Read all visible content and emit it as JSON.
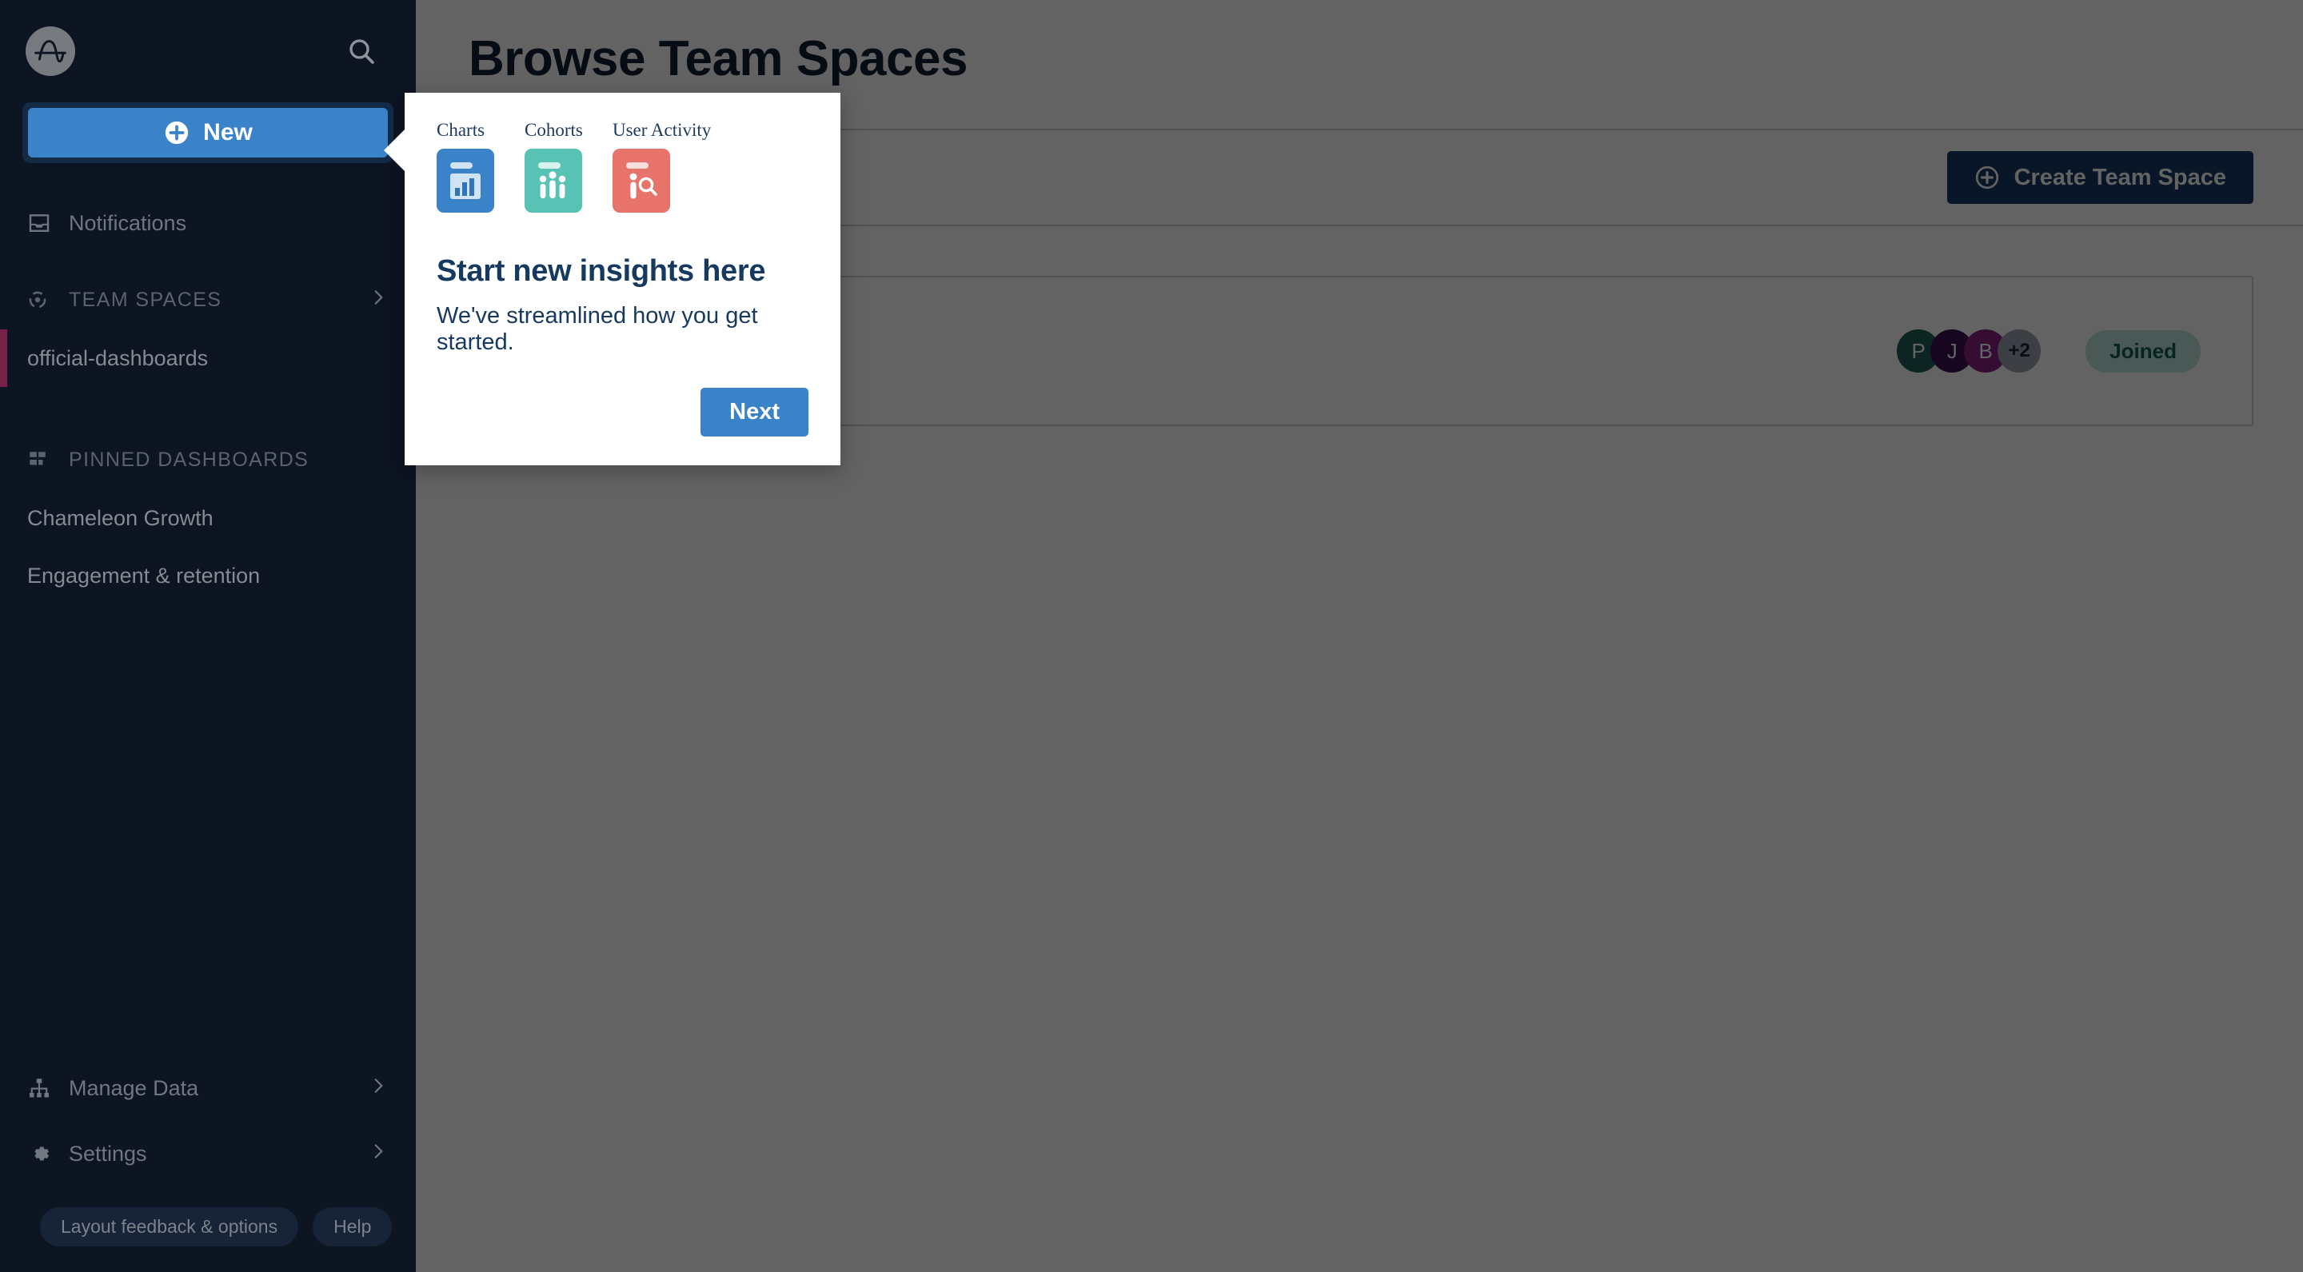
{
  "app": {
    "brand_icon": "amplitude-logo-icon",
    "accent_blue": "#3b83c9",
    "sidebar_bg": "#0d1422",
    "overlay_color": "#646464"
  },
  "sidebar": {
    "search_icon": "search-icon",
    "new_button": {
      "label": "New",
      "icon": "plus-circle-icon"
    },
    "notifications": {
      "label": "Notifications",
      "icon": "inbox-icon"
    },
    "team_spaces": {
      "label": "TEAM SPACES",
      "icon": "team-spaces-icon",
      "chevron": "chevron-right-icon"
    },
    "team_space_items": [
      {
        "label": "official-dashboards",
        "active": true,
        "accent": "#7a2149"
      }
    ],
    "pinned": {
      "label": "PINNED DASHBOARDS",
      "icon": "grid-icon"
    },
    "pinned_items": [
      {
        "label": "Chameleon Growth"
      },
      {
        "label": "Engagement & retention"
      }
    ],
    "bottom_items": [
      {
        "label": "Manage Data",
        "icon": "hierarchy-icon",
        "chevron": "chevron-right-icon"
      },
      {
        "label": "Settings",
        "icon": "gear-icon",
        "chevron": "chevron-right-icon"
      }
    ],
    "pills": [
      {
        "label": "Layout feedback & options"
      },
      {
        "label": "Help"
      }
    ]
  },
  "main": {
    "page_title": "Browse Team Spaces",
    "create_button": {
      "label": "Create Team Space",
      "icon": "plus-circle-icon"
    },
    "space_row": {
      "avatars": [
        {
          "initial": "P",
          "color": "#1f6158"
        },
        {
          "initial": "J",
          "color": "#3b1054"
        },
        {
          "initial": "B",
          "color": "#8a1f80"
        }
      ],
      "overflow_label": "+2",
      "status_badge": "Joined",
      "color_chip": "#5c1536"
    }
  },
  "popover": {
    "tiles": [
      {
        "label": "Charts",
        "icon": "bar-chart-tile-icon",
        "color": "#3b83c9"
      },
      {
        "label": "Cohorts",
        "icon": "people-tile-icon",
        "color": "#58c2b4"
      },
      {
        "label": "User Activity",
        "icon": "user-search-tile-icon",
        "color": "#e8736a"
      }
    ],
    "title": "Start new insights here",
    "subtitle": "We've streamlined how you get started.",
    "next_button": "Next"
  }
}
